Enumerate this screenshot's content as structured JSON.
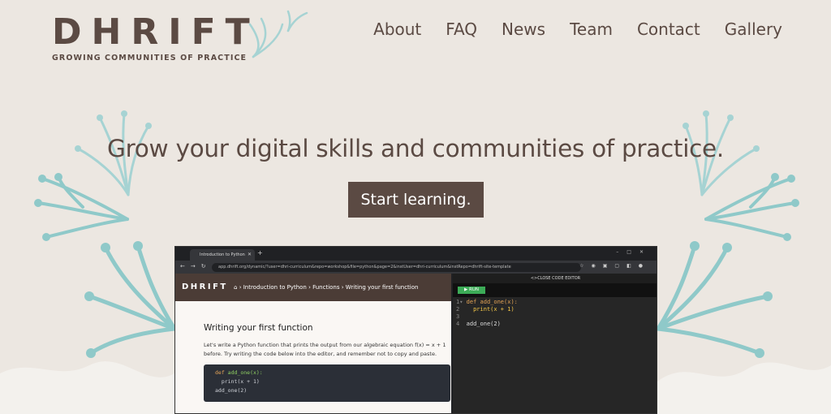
{
  "brand": {
    "logo": "DHRIFT",
    "tagline": "GROWING COMMUNITIES OF PRACTICE"
  },
  "nav": {
    "items": [
      "About",
      "FAQ",
      "News",
      "Team",
      "Contact",
      "Gallery"
    ]
  },
  "hero": {
    "title": "Grow your digital skills and communities of practice.",
    "cta_label": "Start learning."
  },
  "colors": {
    "background": "#ece7e1",
    "brand_brown": "#5b4a43",
    "accent_teal": "#a6d3d3",
    "run_green": "#3cab57"
  },
  "screenshot": {
    "tab_title": "Introduction to Python",
    "url": "app.dhrift.org/dynamic/?user=dhri-curriculum&repo=workshop&file=python&page=2&instUser=dhri-curriculum&instRepo=dhrift-site-template",
    "page": {
      "logo": "DHRIFT",
      "breadcrumb": "› Introduction to Python › Functions › Writing your first function",
      "title": "Writing your first function",
      "paragraph": "Let's write a Python function that prints the output from our algebraic equation f(x) = x + 1 before. Try writing the code below into the editor, and remember not to copy and paste.",
      "code_lines": [
        "def add_one(x):",
        "  print(x + 1)",
        "add_one(2)"
      ]
    },
    "editor": {
      "close_label": "CLOSE CODE EDITOR",
      "run_label": "RUN",
      "line_numbers": [
        "1",
        "2",
        "3",
        "4"
      ],
      "lines": [
        "def add_one(x):",
        "  print(x + 1)",
        "",
        "add_one(2)"
      ]
    }
  },
  "icons": [
    "home-icon",
    "chevron-left-icon",
    "chevron-right-icon",
    "play-icon",
    "dandelion-decoration"
  ]
}
